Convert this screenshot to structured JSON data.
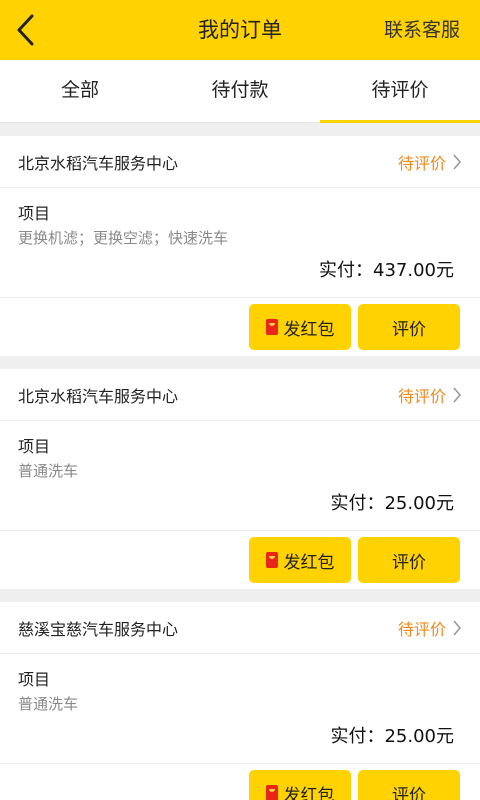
{
  "header": {
    "title": "我的订单",
    "contact_label": "联系客服"
  },
  "tabs": [
    {
      "label": "全部",
      "active": false
    },
    {
      "label": "待付款",
      "active": false
    },
    {
      "label": "待评价",
      "active": true
    }
  ],
  "orders": [
    {
      "shop": "北京水稻汽车服务中心",
      "status": "待评价",
      "item_label": "项目",
      "items": "更换机滤；更换空滤；快速洗车",
      "paid": "实付：437.00元",
      "red_packet_label": "发红包",
      "rate_label": "评价"
    },
    {
      "shop": "北京水稻汽车服务中心",
      "status": "待评价",
      "item_label": "项目",
      "items": "普通洗车",
      "paid": "实付：25.00元",
      "red_packet_label": "发红包",
      "rate_label": "评价"
    },
    {
      "shop": "慈溪宝慈汽车服务中心",
      "status": "待评价",
      "item_label": "项目",
      "items": "普通洗车",
      "paid": "实付：25.00元",
      "red_packet_label": "发红包",
      "rate_label": "评价"
    }
  ],
  "colors": {
    "accent": "#ffd200",
    "status": "#f08a1c",
    "red_packet": "#e8241b"
  }
}
